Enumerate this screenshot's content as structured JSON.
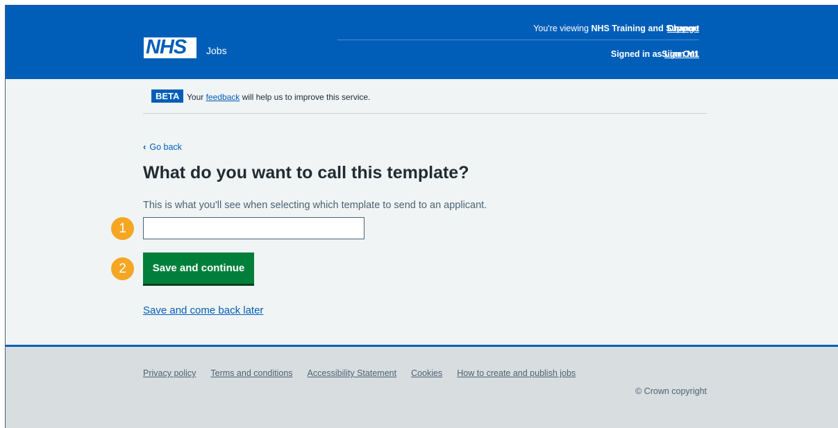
{
  "header": {
    "viewing_prefix": "You're viewing ",
    "viewing_org": "NHS Training and Support",
    "change_label": "Change",
    "logo_text": "NHS",
    "service_name": "Jobs",
    "signed_in_prefix": "Signed in as ",
    "user_name": "Liam M1",
    "sign_out_label": "Sign Out"
  },
  "beta": {
    "tag": "BETA",
    "text_before": "Your ",
    "link": "feedback",
    "text_after": " will help us to improve this service."
  },
  "main": {
    "back_label": "Go back",
    "title": "What do you want to call this template?",
    "hint": "This is what you'll see when selecting which template to send to an applicant.",
    "input_value": "",
    "submit_label": "Save and continue",
    "later_label": "Save and come back later"
  },
  "markers": [
    "1",
    "2"
  ],
  "footer": {
    "links": [
      "Privacy policy",
      "Terms and conditions",
      "Accessibility Statement",
      "Cookies",
      "How to create and publish jobs"
    ],
    "copyright": "© Crown copyright"
  },
  "colors": {
    "nhs_blue": "#005eb8",
    "button_green": "#007f3b",
    "marker_orange": "#f5a623"
  }
}
